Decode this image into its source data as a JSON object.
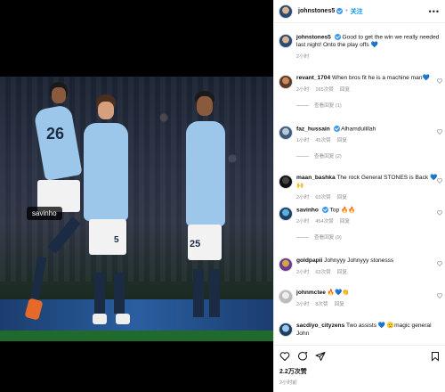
{
  "photo": {
    "tag": "savinho",
    "jersey_numbers": [
      "26",
      "5",
      "25"
    ]
  },
  "post": {
    "author": "johnstones5",
    "follow_label": "关注",
    "separator": "•"
  },
  "comments": [
    {
      "user": "johnstones5",
      "text": "Good to get the win we really needed last night! Onto the play offs 💙",
      "time": "2小时",
      "likes": "",
      "reply": "",
      "replies": ""
    },
    {
      "user": "revant_1704",
      "text": "When bros fit he is a machine man💙",
      "time": "2小时",
      "likes": "165次赞",
      "reply": "回复",
      "replies": "查看回复 (1)"
    },
    {
      "user": "faz_hussain",
      "text": "Alhamdulillah",
      "time": "1小时",
      "likes": "45次赞",
      "reply": "回复",
      "replies": "查看回复 (2)"
    },
    {
      "user": "maan_bashka",
      "text": "The rock General STONES is Back 💙 🙌",
      "time": "2小时",
      "likes": "63次赞",
      "reply": "回复",
      "replies": ""
    },
    {
      "user": "savinho",
      "text": "Top 🔥🔥",
      "time": "2小时",
      "likes": "454次赞",
      "reply": "回复",
      "replies": "查看回复 (9)"
    },
    {
      "user": "goldpapii",
      "text": "Johnyyy Johnyyy stonesss",
      "time": "2小时",
      "likes": "63次赞",
      "reply": "回复",
      "replies": ""
    },
    {
      "user": "johnmctee",
      "text": "🔥💙👏",
      "time": "2小时",
      "likes": "8次赞",
      "reply": "回复",
      "replies": ""
    },
    {
      "user": "sacdiyo_cityzens",
      "text": "Two assists 💙 🫡magic general John",
      "time": "",
      "likes": "",
      "reply": "",
      "replies": ""
    }
  ],
  "footer": {
    "likes": "2.2万次赞",
    "date": "2小时前"
  },
  "colors": {
    "accent": "#0095f6",
    "verified": "#3897f0",
    "city_blue": "#9cc7ea"
  }
}
